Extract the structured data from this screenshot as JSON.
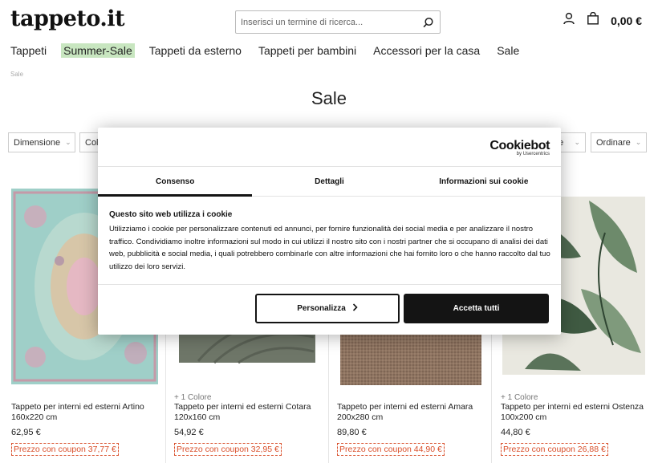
{
  "header": {
    "logo": "tappeto.it",
    "search_placeholder": "Inserisci un termine di ricerca...",
    "cart_total": "0,00 €"
  },
  "nav": [
    {
      "label": "Tappeti"
    },
    {
      "label": "Summer-Sale"
    },
    {
      "label": "Tappeti da esterno"
    },
    {
      "label": "Tappeti per bambini"
    },
    {
      "label": "Accessori per la casa"
    },
    {
      "label": "Sale"
    }
  ],
  "breadcrumb": "Sale",
  "page_title": "Sale",
  "filters": {
    "dimension": "Dimensione",
    "color_partial": "Colo",
    "partial_right": "ne",
    "sort": "Ordinare"
  },
  "products": [
    {
      "colors": "",
      "name": "Tappeto per interni ed esterni Artino 160x220 cm",
      "price": "62,95 €",
      "coupon": "Prezzo con coupon 37,77 €"
    },
    {
      "colors": "+ 1 Colore",
      "name": "Tappeto per interni ed esterni Cotara 120x160 cm",
      "price": "54,92 €",
      "coupon": "Prezzo con coupon 32,95 €"
    },
    {
      "colors": "",
      "name": "Tappeto per interni ed esterni Amara 200x280 cm",
      "price": "89,80 €",
      "coupon": "Prezzo con coupon 44,90 €"
    },
    {
      "colors": "+ 1 Colore",
      "name": "Tappeto per interni ed esterni Ostenza 100x200 cm",
      "price": "44,80 €",
      "coupon": "Prezzo con coupon 26,88 €"
    }
  ],
  "cookie": {
    "brand": "Cookiebot",
    "brand_sub": "by Usercentrics",
    "tabs": [
      "Consenso",
      "Dettagli",
      "Informazioni sui cookie"
    ],
    "heading": "Questo sito web utilizza i cookie",
    "body": "Utilizziamo i cookie per personalizzare contenuti ed annunci, per fornire funzionalità dei social media e per analizzare il nostro traffico. Condividiamo inoltre informazioni sul modo in cui utilizzi il nostro sito con i nostri partner che si occupano di analisi dei dati web, pubblicità e social media, i quali potrebbero combinarle con altre informazioni che hai fornito loro o che hanno raccolto dal tuo utilizzo dei loro servizi.",
    "btn_customize": "Personalizza",
    "btn_accept": "Accetta tutti"
  }
}
